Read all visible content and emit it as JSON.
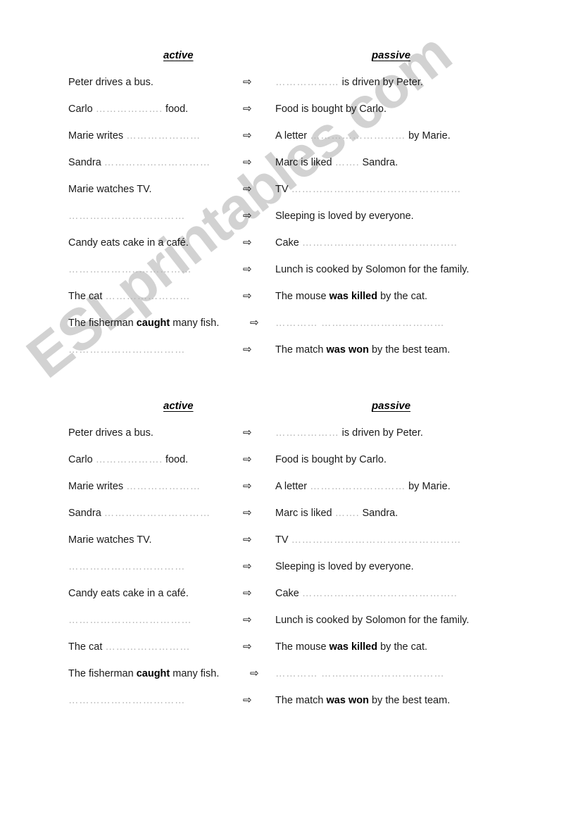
{
  "watermark": {
    "text": "ESLprintables.com",
    "color": "#d2d2d2"
  },
  "headers": {
    "active": "active",
    "passive": "passive"
  },
  "symbols": {
    "arrow": "⇨",
    "dots_long": "…………………………",
    "dots_short": "………"
  },
  "blocks": [
    {
      "id": "block-0",
      "rows": [
        {
          "active_pre": "Peter drives a bus.",
          "active_dots": "",
          "active_post": "",
          "active_bold": "",
          "passive_pre": "",
          "passive_dots": "………………",
          "passive_post": " is driven by Peter.",
          "tight": false
        },
        {
          "active_pre": "Carlo ",
          "active_dots": "……………….",
          "active_post": " food.",
          "active_bold": "",
          "passive_pre": "Food is bought by Carlo.",
          "passive_dots": "",
          "passive_post": "",
          "tight": false
        },
        {
          "active_pre": "Marie writes  ",
          "active_dots": "…………………",
          "active_post": "",
          "active_bold": "",
          "passive_pre": "A letter ",
          "passive_dots": "………………………",
          "passive_post": " by Marie.",
          "tight": false
        },
        {
          "active_pre": "Sandra ",
          "active_dots": "…………………………",
          "active_post": "",
          "active_bold": "",
          "passive_pre": "Marc is liked ",
          "passive_dots": "…….",
          "passive_post": " Sandra.",
          "tight": false
        },
        {
          "active_pre": "Marie watches TV.",
          "active_dots": "",
          "active_post": "",
          "active_bold": "",
          "passive_pre": "TV ",
          "passive_dots": "…………………………………………",
          "passive_post": "",
          "tight": false
        },
        {
          "active_pre": "",
          "active_dots": "……………………………",
          "active_post": "",
          "active_bold": "",
          "passive_pre": "Sleeping is loved by everyone.",
          "passive_dots": "",
          "passive_post": "",
          "tight": false
        },
        {
          "active_pre": "Candy eats cake in a café.",
          "active_dots": "",
          "active_post": "",
          "active_bold": "",
          "passive_pre": "Cake ",
          "passive_dots": "……………………………………..",
          "passive_post": "",
          "tight": false
        },
        {
          "active_pre": "",
          "active_dots": "………………..……………",
          "active_post": "",
          "active_bold": "",
          "passive_pre": "Lunch is cooked by Solomon for the family.",
          "passive_dots": "",
          "passive_post": "",
          "tight": false
        },
        {
          "active_pre": "The cat ",
          "active_dots": "……………………",
          "active_post": "",
          "active_bold": "",
          "passive_pre": "The mouse ",
          "passive_dots": "",
          "passive_post": " by the cat.",
          "passive_bold": "was killed",
          "tight": false
        },
        {
          "active_pre": "The fisherman ",
          "active_dots": "",
          "active_post": " many fish.",
          "active_bold": "caught",
          "passive_pre": "",
          "passive_dots": "………… ……..………………………",
          "passive_post": "",
          "tight": true
        },
        {
          "active_pre": "",
          "active_dots": "……………………………",
          "active_post": "",
          "active_bold": "",
          "passive_pre": "The match ",
          "passive_dots": "",
          "passive_post": " by the best team.",
          "passive_bold": "was won",
          "tight": false
        }
      ]
    },
    {
      "id": "block-1",
      "rows": [
        {
          "active_pre": "Peter drives a bus.",
          "active_dots": "",
          "active_post": "",
          "active_bold": "",
          "passive_pre": "",
          "passive_dots": "………………",
          "passive_post": " is driven by Peter.",
          "tight": false
        },
        {
          "active_pre": "Carlo ",
          "active_dots": "……………….",
          "active_post": " food.",
          "active_bold": "",
          "passive_pre": "Food is bought by Carlo.",
          "passive_dots": "",
          "passive_post": "",
          "tight": false
        },
        {
          "active_pre": "Marie writes  ",
          "active_dots": "…………………",
          "active_post": "",
          "active_bold": "",
          "passive_pre": "A letter ",
          "passive_dots": "………………………",
          "passive_post": " by Marie.",
          "tight": false
        },
        {
          "active_pre": "Sandra ",
          "active_dots": "…………………………",
          "active_post": "",
          "active_bold": "",
          "passive_pre": "Marc is liked ",
          "passive_dots": "…….",
          "passive_post": " Sandra.",
          "tight": false
        },
        {
          "active_pre": "Marie watches TV.",
          "active_dots": "",
          "active_post": "",
          "active_bold": "",
          "passive_pre": "TV ",
          "passive_dots": "…………………………………………",
          "passive_post": "",
          "tight": false
        },
        {
          "active_pre": "",
          "active_dots": "……………………………",
          "active_post": "",
          "active_bold": "",
          "passive_pre": "Sleeping is loved by everyone.",
          "passive_dots": "",
          "passive_post": "",
          "tight": false
        },
        {
          "active_pre": "Candy eats cake in a café.",
          "active_dots": "",
          "active_post": "",
          "active_bold": "",
          "passive_pre": "Cake ",
          "passive_dots": "……………………………………..",
          "passive_post": "",
          "tight": false
        },
        {
          "active_pre": "",
          "active_dots": "………………..……………",
          "active_post": "",
          "active_bold": "",
          "passive_pre": "Lunch is cooked by Solomon for the family.",
          "passive_dots": "",
          "passive_post": "",
          "tight": false
        },
        {
          "active_pre": "The cat ",
          "active_dots": "……………………",
          "active_post": "",
          "active_bold": "",
          "passive_pre": "The mouse ",
          "passive_dots": "",
          "passive_post": " by the cat.",
          "passive_bold": "was killed",
          "tight": false
        },
        {
          "active_pre": "The fisherman ",
          "active_dots": "",
          "active_post": " many fish.",
          "active_bold": "caught",
          "passive_pre": "",
          "passive_dots": "………… ……..………………………",
          "passive_post": "",
          "tight": true
        },
        {
          "active_pre": "",
          "active_dots": "……………………………",
          "active_post": "",
          "active_bold": "",
          "passive_pre": "The match ",
          "passive_dots": "",
          "passive_post": " by the best team.",
          "passive_bold": "was won",
          "tight": false
        }
      ]
    }
  ]
}
